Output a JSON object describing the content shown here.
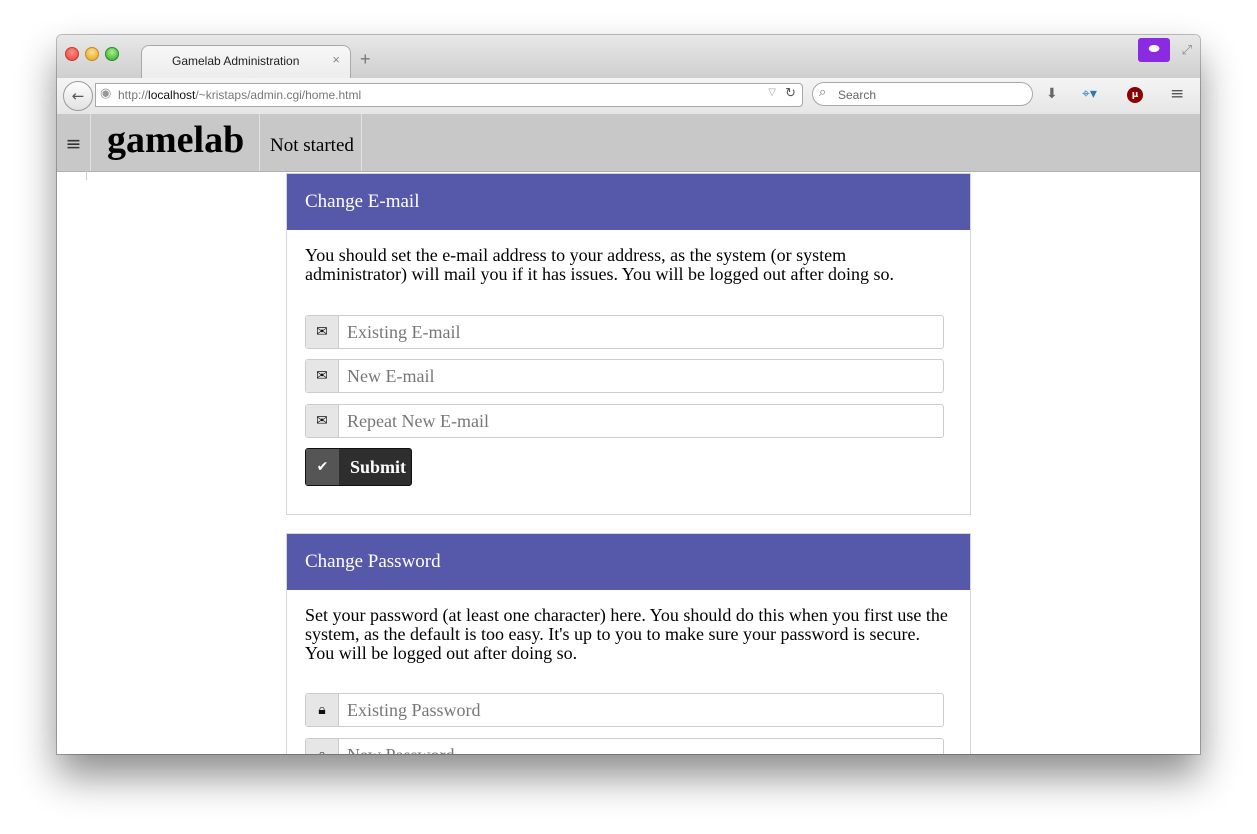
{
  "browser": {
    "tab_title": "Gamelab Administration",
    "tab_close": "×",
    "new_tab": "+",
    "url_scheme": "http://",
    "url_host": "localhost",
    "url_path": "/~kristaps/admin.cgi/home.html",
    "search_placeholder": "Search",
    "icons": [
      "back-arrow",
      "globe",
      "reload",
      "search",
      "download",
      "ublock",
      "menu",
      "privacy-mask",
      "fullscreen"
    ]
  },
  "appbar": {
    "menu_glyph": "≡",
    "brand": "gamelab",
    "status": "Not started"
  },
  "email_panel": {
    "title": "Change E-mail",
    "description": "You should set the e-mail address to your address, as the system (or system administrator) will mail you if it has issues. You will be logged out after doing so.",
    "fields": [
      {
        "placeholder": "Existing E-mail",
        "icon": "envelope-filled"
      },
      {
        "placeholder": "New E-mail",
        "icon": "envelope-outline"
      },
      {
        "placeholder": "Repeat New E-mail",
        "icon": "envelope-outline"
      }
    ],
    "submit_label": "Submit"
  },
  "password_panel": {
    "title": "Change Password",
    "description": "Set your password (at least one character) here. You should do this when you first use the system, as the default is too easy. It's up to you to make sure your password is secure. You will be logged out after doing so.",
    "fields": [
      {
        "placeholder": "Existing Password",
        "icon": "lock"
      },
      {
        "placeholder": "New Password",
        "icon": "lock"
      }
    ]
  },
  "colors": {
    "panel_header": "#5658a9",
    "appbar": "#c8c8c8",
    "submit": "#2e2e2e"
  }
}
